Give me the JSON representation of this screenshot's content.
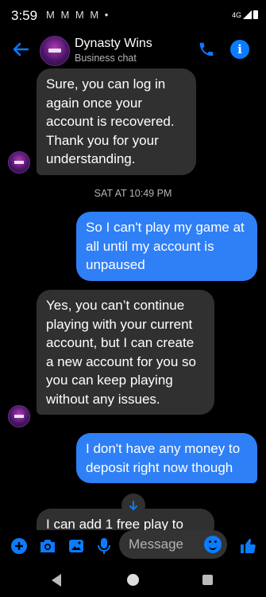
{
  "status_bar": {
    "time": "3:59",
    "notification_icons": "M M M M •",
    "network": "4G"
  },
  "header": {
    "title": "Dynasty Wins",
    "subtitle": "Business chat"
  },
  "messages": [
    {
      "direction": "incoming",
      "text": "Sure, you can log in again once your account is recovered. Thank you for your understanding."
    },
    {
      "direction": "outgoing",
      "text": "So I can't play my game at all until my account is unpaused"
    },
    {
      "direction": "incoming",
      "text": "Yes, you can’t continue playing with your current account, but I can create a new account for you so you can keep playing without any issues."
    },
    {
      "direction": "outgoing",
      "text": "I don't have any money to deposit right now though"
    },
    {
      "direction": "incoming",
      "text": "I can add 1 free play to"
    }
  ],
  "timestamp": "SAT AT 10:49 PM",
  "composer": {
    "placeholder": "Message"
  },
  "colors": {
    "accent": "#0a7cff",
    "outgoing_bubble": "#2f7ff7",
    "incoming_bubble": "#303030",
    "background": "#000000"
  },
  "icons": [
    "back-arrow-icon",
    "phone-icon",
    "info-icon",
    "plus-icon",
    "camera-icon",
    "gallery-icon",
    "mic-icon",
    "emoji-icon",
    "like-icon",
    "chevron-down-icon"
  ]
}
